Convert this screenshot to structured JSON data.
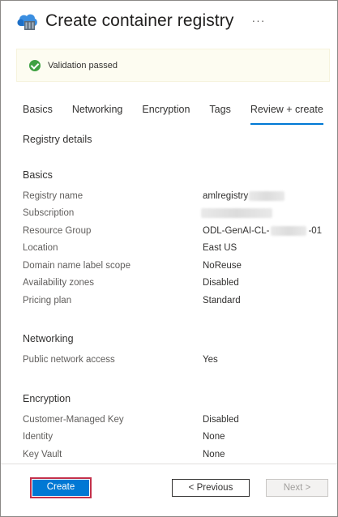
{
  "header": {
    "title": "Create container registry",
    "more_label": "···"
  },
  "banner": {
    "text": "Validation passed"
  },
  "tabs": [
    {
      "label": "Basics"
    },
    {
      "label": "Networking"
    },
    {
      "label": "Encryption"
    },
    {
      "label": "Tags"
    },
    {
      "label": "Review + create",
      "active": true
    }
  ],
  "registry_details_title": "Registry details",
  "basics": {
    "title": "Basics",
    "rows": [
      {
        "label": "Registry name",
        "value": "amlregistry"
      },
      {
        "label": "Subscription",
        "value": ""
      },
      {
        "label": "Resource Group",
        "value": "ODL-GenAI-CL-",
        "value_suffix": "-01"
      },
      {
        "label": "Location",
        "value": "East US"
      },
      {
        "label": "Domain name label scope",
        "value": "NoReuse"
      },
      {
        "label": "Availability zones",
        "value": "Disabled"
      },
      {
        "label": "Pricing plan",
        "value": "Standard"
      }
    ]
  },
  "networking": {
    "title": "Networking",
    "rows": [
      {
        "label": "Public network access",
        "value": "Yes"
      }
    ]
  },
  "encryption": {
    "title": "Encryption",
    "rows": [
      {
        "label": "Customer-Managed Key",
        "value": "Disabled"
      },
      {
        "label": "Identity",
        "value": "None"
      },
      {
        "label": "Key Vault",
        "value": "None"
      }
    ]
  },
  "footer": {
    "create_label": "Create",
    "previous_label": "< Previous",
    "next_label": "Next >"
  },
  "colors": {
    "accent": "#0078d4",
    "success": "#3fa142",
    "highlight_border": "#c4314b"
  }
}
